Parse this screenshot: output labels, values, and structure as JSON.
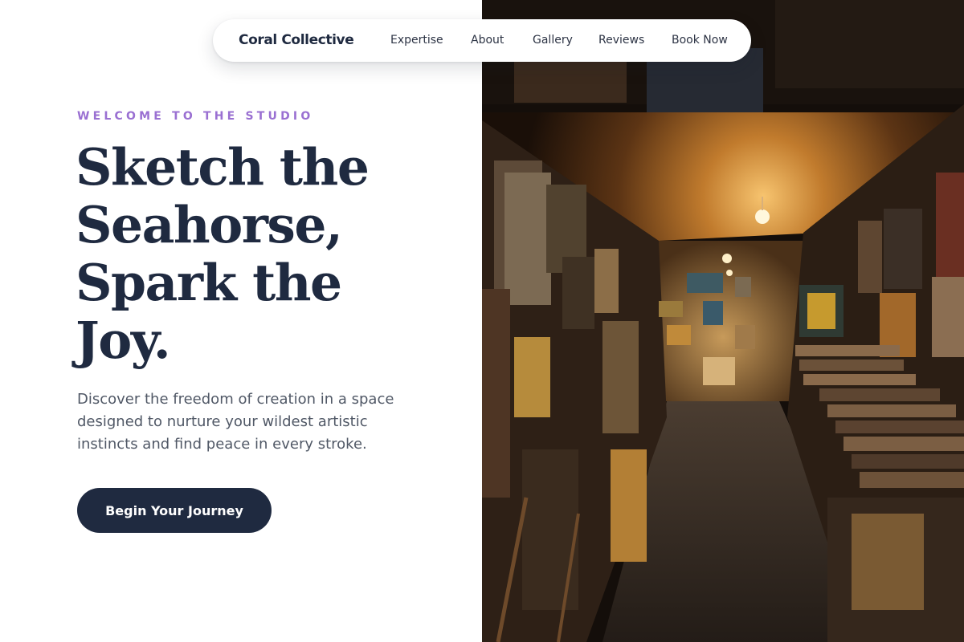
{
  "nav": {
    "brand": "Coral Collective",
    "links": [
      "Expertise",
      "About",
      "Gallery",
      "Reviews",
      "Book Now"
    ]
  },
  "hero": {
    "eyebrow": "WELCOME TO THE STUDIO",
    "headline_lines": [
      "Sketch the",
      "Seahorse,",
      "Spark the",
      "Joy."
    ],
    "description_lines": [
      "Discover the freedom of creation in a space",
      "designed to nurture your wildest artistic",
      "instincts and find peace in every stroke."
    ],
    "cta_label": "Begin Your Journey"
  },
  "colors": {
    "navy": "#1f2a40",
    "eyebrow_purple": "#9a70d2",
    "body_text": "#505866"
  },
  "image": {
    "subject": "art-gallery-alley-photo"
  }
}
